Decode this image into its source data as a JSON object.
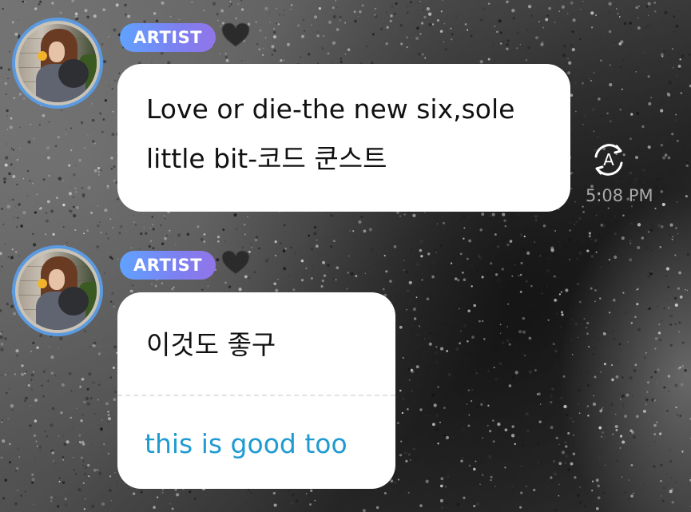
{
  "messages": [
    {
      "badge": "ARTIST",
      "text_lines": [
        "Love or die-the new six,sole",
        "little bit-코드 쿤스트"
      ],
      "time": "5:08 PM"
    },
    {
      "badge": "ARTIST",
      "text": "이것도 좋구",
      "translation": "this is good too"
    }
  ],
  "colors": {
    "avatar_ring": "#5b9ae0",
    "badge_gradient": [
      "#60a2ff",
      "#9175e8"
    ],
    "bubble": "#ffffff",
    "message_text": "#111111",
    "translation_text": "#1f9bd1",
    "heart": "#2b2b2b"
  },
  "icons": {
    "heart": "black-heart-icon",
    "translate": "translate-icon",
    "avatar": "artist-avatar"
  }
}
